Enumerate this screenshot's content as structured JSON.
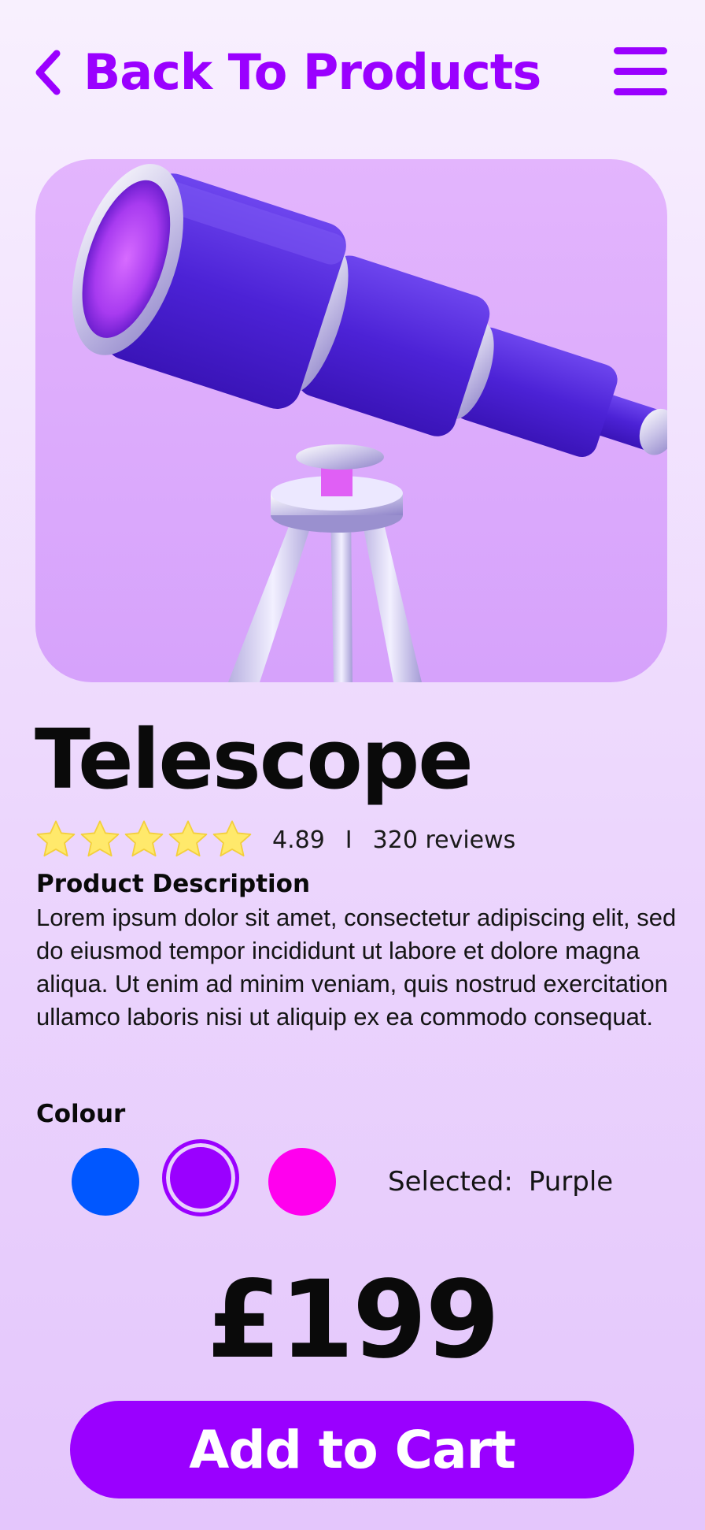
{
  "header": {
    "back_label": "Back To Products",
    "back_icon": "chevron-left-icon",
    "menu_icon": "hamburger-menu-icon"
  },
  "product": {
    "image_icon": "telescope-illustration",
    "name": "Telescope",
    "rating": {
      "stars": 5,
      "stars_filled": 5,
      "value": "4.89",
      "separator": "I",
      "reviews": "320 reviews"
    },
    "description_heading": "Product Description",
    "description": "Lorem ipsum dolor sit amet, consectetur adipiscing elit, sed do eiusmod tempor incididunt ut labore et dolore magna aliqua. Ut enim ad minim veniam, quis nostrud exercitation ullamco laboris nisi ut aliquip ex ea commodo consequat.",
    "price": "£199"
  },
  "colour": {
    "heading": "Colour",
    "options": [
      {
        "name": "Blue",
        "hex": "#0057ff"
      },
      {
        "name": "Purple",
        "hex": "#9a00ff"
      },
      {
        "name": "Pink",
        "hex": "#ff00ee"
      }
    ],
    "selected_label": "Selected:",
    "selected_value": "Purple"
  },
  "actions": {
    "add_to_cart_label": "Add to Cart"
  },
  "colors": {
    "accent": "#9a00ff",
    "hero_background": "#dca9fc",
    "star": "#ffe96b"
  }
}
